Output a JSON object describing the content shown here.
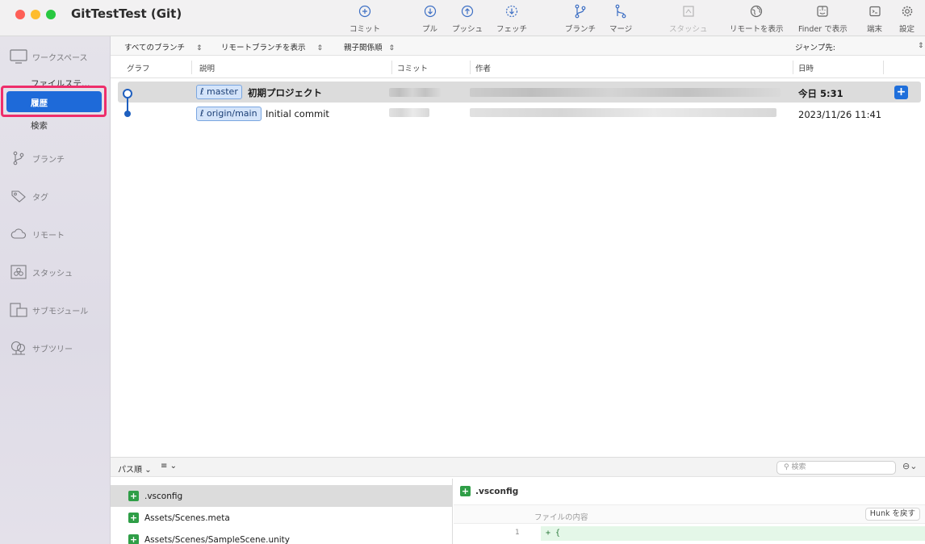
{
  "window": {
    "title": "GitTestTest (Git)"
  },
  "toolbar": {
    "commit": "コミット",
    "pull": "プル",
    "push": "プッシュ",
    "fetch": "フェッチ",
    "branch": "ブランチ",
    "merge": "マージ",
    "stash": "スタッシュ",
    "remote_show": "リモートを表示",
    "finder_show": "Finder で表示",
    "terminal": "端末",
    "settings": "設定"
  },
  "sidebar": {
    "workspace": "ワークスペース",
    "file_status": "ファイルステ…",
    "history": "履歴",
    "search": "検索",
    "branches": "ブランチ",
    "tags": "タグ",
    "remotes": "リモート",
    "stashes": "スタッシュ",
    "submodules": "サブモジュール",
    "subtrees": "サブツリー"
  },
  "filterbar": {
    "branches": "すべてのブランチ",
    "remote": "リモートブランチを表示",
    "order": "親子関係順",
    "jump": "ジャンプ先:"
  },
  "columns": {
    "graph": "グラフ",
    "description": "説明",
    "commit": "コミット",
    "author": "作者",
    "date": "日時"
  },
  "commits": [
    {
      "branch": "master",
      "message": "初期プロジェクト",
      "date": "今日 5:31"
    },
    {
      "branch": "origin/main",
      "message": "Initial commit",
      "date": "2023/11/26 11:41"
    }
  ],
  "bottom": {
    "sort": "パス順",
    "search_placeholder": "検索",
    "files": [
      ".vsconfig",
      "Assets/Scenes.meta",
      "Assets/Scenes/SampleScene.unity"
    ],
    "diff_file": ".vsconfig",
    "file_content": "ファイルの内容",
    "hunk_button": "Hunk を戻す",
    "diff_line_number": "1",
    "diff_line": "+ {"
  }
}
